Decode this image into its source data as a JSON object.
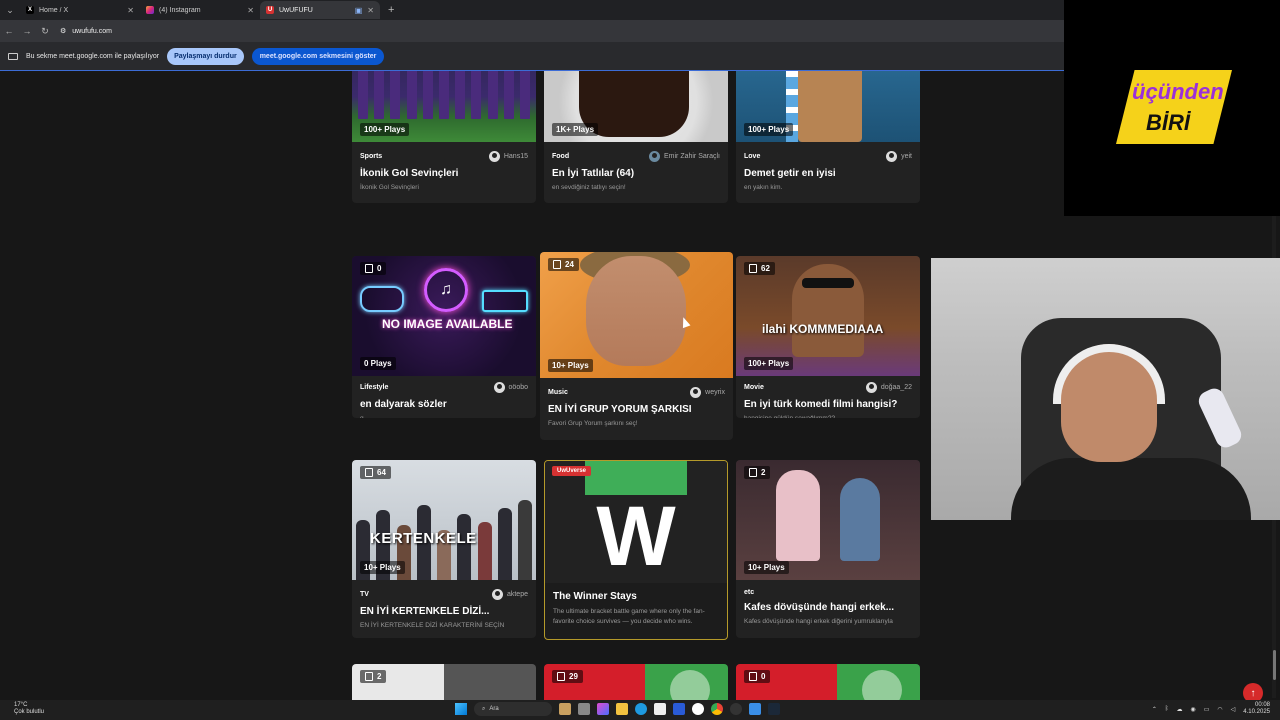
{
  "browser": {
    "tabs": [
      {
        "title": "Home / X",
        "icon": "x-logo-icon",
        "active": false
      },
      {
        "title": "(4) Instagram",
        "icon": "instagram-icon",
        "active": false
      },
      {
        "title": "UwUFUFU",
        "icon": "uwufufu-icon",
        "active": true
      }
    ],
    "url": "uwufufu.com",
    "share_notice": "Bu sekme meet.google.com ile paylaşılıyor",
    "stop_sharing": "Paylaşmayı durdur",
    "show_tab": "meet.google.com sekmesini göster"
  },
  "cards": [
    {
      "id": "c1",
      "category": "Sports",
      "author": "Hans15",
      "title": "İkonik Gol Sevinçleri",
      "desc": "İkonik Gol Sevinçleri",
      "plays": "100+ Plays"
    },
    {
      "id": "c2",
      "category": "Food",
      "author": "Emir Zahir Saraçlı",
      "title": "En İyi Tatlılar (64)",
      "desc": "en sevdiğiniz tatlıyı seçin!",
      "plays": "1K+ Plays"
    },
    {
      "id": "c3",
      "category": "Love",
      "author": "yeit",
      "title": "Demet getir en iyisi",
      "desc": "en yakın kim.",
      "plays": "100+ Plays"
    },
    {
      "id": "c4",
      "category": "Lifestyle",
      "author": "oöobo",
      "title": "en dalyarak sözler",
      "desc": "q",
      "plays": "0 Plays",
      "count": "0",
      "thumb_text": "NO IMAGE AVAILABLE"
    },
    {
      "id": "c5",
      "category": "Music",
      "author": "weyrix",
      "title": "EN İYİ GRUP YORUM ŞARKISI",
      "desc": "Favori Grup Yorum şarkını seç!",
      "plays": "10+ Plays",
      "count": "24"
    },
    {
      "id": "c6",
      "category": "Movie",
      "author": "doğaa_22",
      "title": "En iyi türk komedi filmi hangisi?",
      "desc": "hangisine güldün sewağlımm??",
      "plays": "100+ Plays",
      "count": "62",
      "thumb_text": "ilahi KOMMMEDIAAA"
    },
    {
      "id": "c7",
      "category": "TV",
      "author": "aktepe",
      "title": "EN İYİ KERTENKELE DİZİ...",
      "desc": "EN İYİ KERTENKELE DİZİ KARAKTERİNİ SEÇİN",
      "plays": "10+ Plays",
      "count": "64",
      "thumb_text": "KERTENKELE"
    },
    {
      "id": "c8",
      "badge": "UwUverse",
      "title": "The Winner Stays",
      "desc": "The ultimate bracket battle game where only the fan-favorite choice survives — you decide who wins.",
      "logo_letter": "W"
    },
    {
      "id": "c9",
      "category": "etc",
      "author": "",
      "title": "Kafes dövüşünde hangi erkek...",
      "desc": "Kafes dövüşünde hangi erkek diğerini yumruklarıyla",
      "plays": "10+ Plays",
      "count": "2"
    }
  ],
  "row4": [
    {
      "count": "2"
    },
    {
      "count": "29"
    },
    {
      "count": "0"
    }
  ],
  "overlay": {
    "logo_top": "üçünden",
    "logo_bottom": "BİRİ"
  },
  "taskbar": {
    "weather_temp": "17°C",
    "weather_desc": "Çok bulutlu",
    "search_placeholder": "Ara",
    "time": "00:08",
    "date": "4.10.2025"
  },
  "colors": {
    "page_bg": "#171717",
    "card_bg": "#222222",
    "promo_border": "#b59a2a",
    "badge_red": "#d63232",
    "logo_yellow": "#f5d21a",
    "logo_purple": "#9b30d9"
  }
}
